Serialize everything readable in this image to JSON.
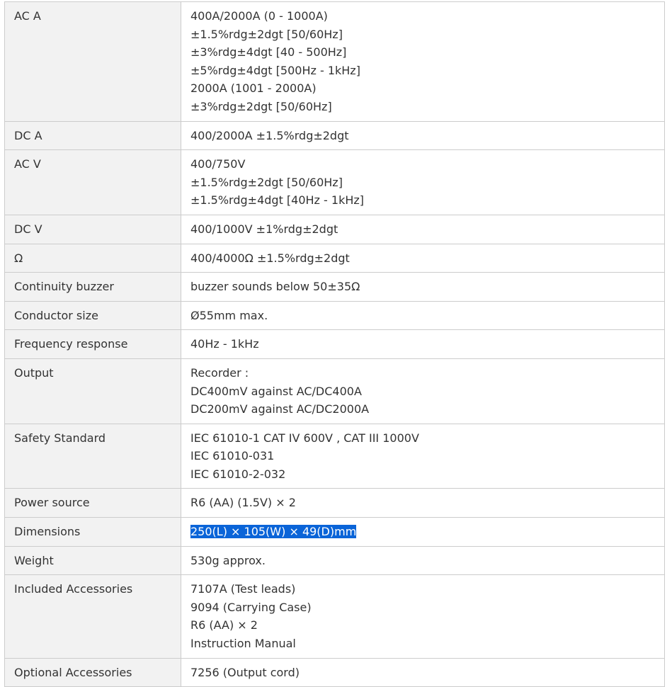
{
  "spec_table": {
    "rows": [
      {
        "label": "AC A",
        "values": [
          "400A/2000A (0 - 1000A)",
          "±1.5%rdg±2dgt [50/60Hz]",
          "±3%rdg±4dgt [40 - 500Hz]",
          "±5%rdg±4dgt [500Hz - 1kHz]",
          "2000A (1001 - 2000A)",
          "±3%rdg±2dgt [50/60Hz]"
        ]
      },
      {
        "label": "DC A",
        "values": [
          "400/2000A ±1.5%rdg±2dgt"
        ]
      },
      {
        "label": "AC V",
        "values": [
          "400/750V",
          "±1.5%rdg±2dgt [50/60Hz]",
          "±1.5%rdg±4dgt [40Hz - 1kHz]"
        ]
      },
      {
        "label": "DC V",
        "values": [
          "400/1000V ±1%rdg±2dgt"
        ]
      },
      {
        "label": "Ω",
        "values": [
          "400/4000Ω ±1.5%rdg±2dgt"
        ]
      },
      {
        "label": "Continuity buzzer",
        "values": [
          "buzzer sounds below 50±35Ω"
        ]
      },
      {
        "label": "Conductor size",
        "values": [
          "Ø55mm max."
        ]
      },
      {
        "label": "Frequency response",
        "values": [
          "40Hz - 1kHz"
        ]
      },
      {
        "label": "Output",
        "values": [
          "Recorder :",
          "DC400mV against AC/DC400A",
          "DC200mV against AC/DC2000A"
        ]
      },
      {
        "label": "Safety Standard",
        "values": [
          "IEC 61010-1 CAT IV 600V , CAT III 1000V",
          "IEC 61010-031",
          "IEC 61010-2-032"
        ]
      },
      {
        "label": "Power source",
        "values": [
          "R6 (AA) (1.5V) × 2"
        ]
      },
      {
        "label": "Dimensions",
        "values": [
          "250(L) × 105(W) × 49(D)mm"
        ],
        "selected": true
      },
      {
        "label": "Weight",
        "values": [
          "530g approx."
        ]
      },
      {
        "label": "Included Accessories",
        "values": [
          "7107A (Test leads)",
          "9094 (Carrying Case)",
          "R6 (AA) × 2",
          "Instruction Manual"
        ]
      },
      {
        "label": "Optional Accessories",
        "values": [
          "7256 (Output cord)"
        ]
      }
    ]
  }
}
